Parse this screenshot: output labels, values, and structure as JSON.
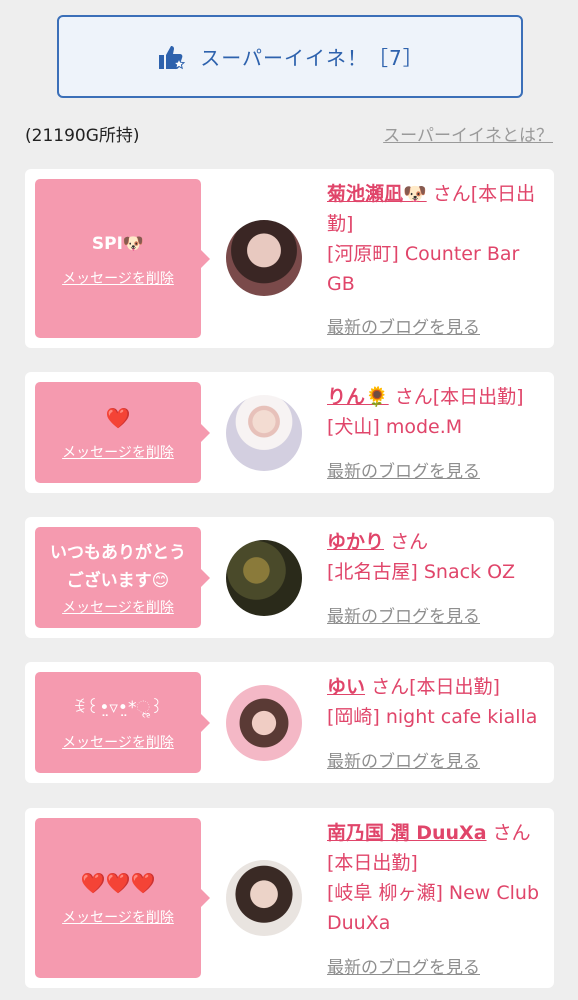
{
  "header": {
    "super_button_label": "スーパーイイネ！［7］",
    "points": "(21190G所持)",
    "about_link": "スーパーイイネとは？"
  },
  "cards": [
    {
      "message": "SPI🐶",
      "delete_label": "メッセージを削除",
      "name": "菊池瀬凪🐶",
      "suffix": "さん[本日出勤]",
      "shop": "[河原町] Counter Bar GB",
      "blog": "最新のブログを見る"
    },
    {
      "message": "❤️",
      "delete_label": "メッセージを削除",
      "name": "りん🌻",
      "suffix": "さん[本日出勤]",
      "shop": "[犬山] mode.M",
      "blog": "最新のブログを見る"
    },
    {
      "message": "いつもありがとうございます😊",
      "delete_label": "メッセージを削除",
      "name": "ゆかり",
      "suffix": "さん",
      "shop": "[北名古屋] Snack OZ",
      "blog": "最新のブログを見る"
    },
    {
      "message": "ꉂ꒰•̤▿•̤*ૢ꒱",
      "delete_label": "メッセージを削除",
      "name": "ゆい",
      "suffix": "さん[本日出勤]",
      "shop": "[岡崎] night cafe kialla",
      "blog": "最新のブログを見る"
    },
    {
      "message": "❤️❤️❤️",
      "delete_label": "メッセージを削除",
      "name": "南乃国 潤 DuuXa",
      "suffix": "さん[本日出勤]",
      "shop": "[岐阜 柳ヶ瀬] New Club DuuXa",
      "blog": "最新のブログを見る"
    }
  ],
  "colors": {
    "accent_pink": "#f59aaf",
    "name_pink": "#e0456a",
    "button_blue": "#2e62ad"
  }
}
